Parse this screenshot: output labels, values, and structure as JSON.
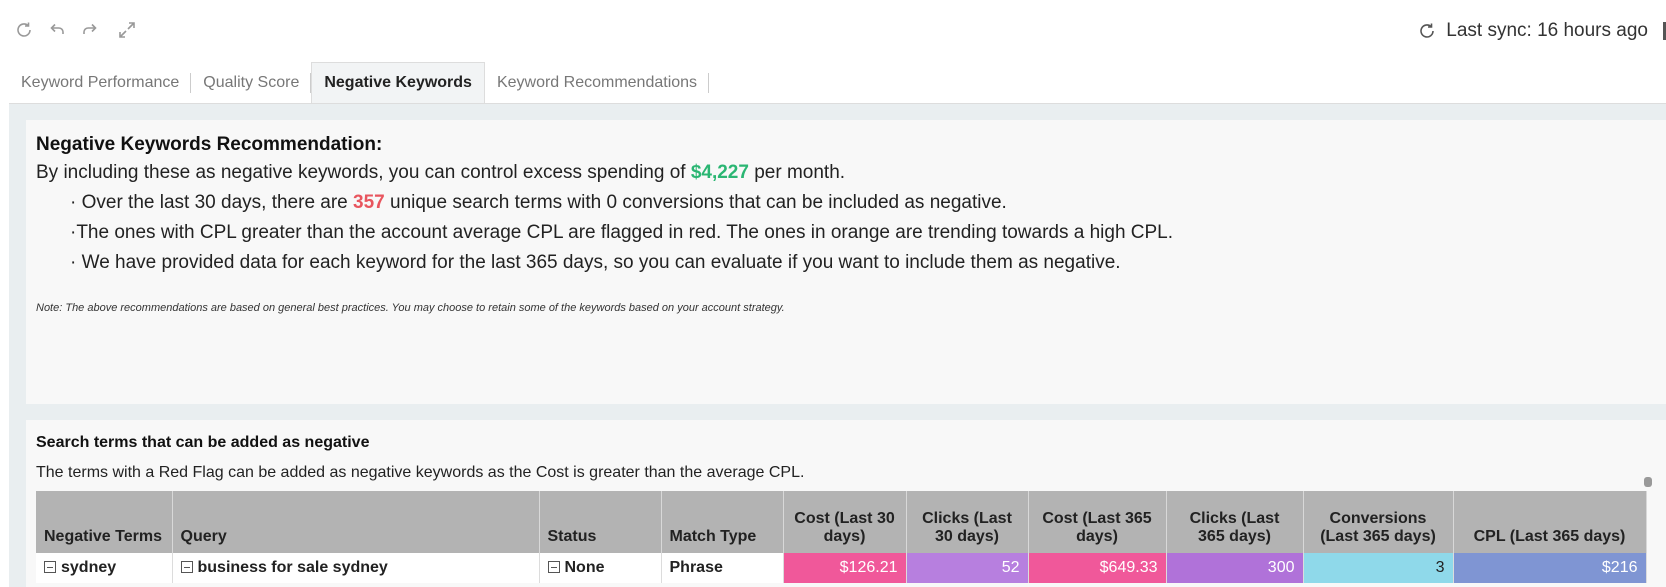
{
  "toolbar": {
    "icons": [
      "refresh-icon",
      "undo-icon",
      "redo-icon",
      "fullscreen-icon"
    ],
    "sync_label": "Last sync: 16 hours ago"
  },
  "tabs": [
    {
      "label": "Keyword Performance",
      "active": false
    },
    {
      "label": "Quality Score",
      "active": false
    },
    {
      "label": "Negative Keywords",
      "active": true
    },
    {
      "label": "Keyword Recommendations",
      "active": false
    }
  ],
  "recommendation": {
    "title": "Negative Keywords Recommendation:",
    "sub_before": "By including these as negative keywords, you can control excess spending of ",
    "sub_amount": "$4,227",
    "sub_after": " per month.",
    "bullet1_before": "Over the last 30 days, there are ",
    "bullet1_count": "357",
    "bullet1_after": " unique search terms with 0 conversions that can be included as negative.",
    "bullet2": "The ones with CPL greater than the account average CPL are flagged in red. The ones in orange are trending towards a high CPL.",
    "bullet3": " We have provided data for each keyword for the last 365 days, so you can evaluate if you want to include them as negative.",
    "bullet_char": "·",
    "note": "Note: The above recommendations are based on general best practices. You may choose to retain some of the keywords based on your account strategy.",
    "colors": {
      "amount": "#2bb673",
      "count": "#e8555e"
    }
  },
  "table": {
    "title": "Search terms that can be added as negative",
    "description": "The terms with a Red Flag can be added as negative keywords as the Cost is greater than the average CPL.",
    "headers": {
      "negative_terms": "Negative Terms",
      "query": "Query",
      "status": "Status",
      "match_type": "Match Type",
      "cost_30": "Cost (Last 30 days)",
      "clicks_30": "Clicks (Last 30 days)",
      "cost_365": "Cost (Last 365 days)",
      "clicks_365": "Clicks        (Last 365 days)",
      "conversions_365": "Conversions (Last 365 days)",
      "cpl_365": "CPL (Last 365 days)"
    },
    "rows": [
      {
        "negative_term": "sydney",
        "query": "business for sale sydney",
        "status": "None",
        "match_type": "Phrase",
        "cost_30": "$126.21",
        "clicks_30": "52",
        "cost_365": "$649.33",
        "clicks_365": "300",
        "conversions_365": "3",
        "cpl_365": "$216"
      }
    ],
    "cell_colors": {
      "cost_30": "#f0589a",
      "clicks_30": "#b77fdf",
      "cost_365": "#f0589a",
      "clicks_365": "#b072d9",
      "conversions_365": "#8fd9ea",
      "cpl_365": "#7f95d3"
    }
  }
}
